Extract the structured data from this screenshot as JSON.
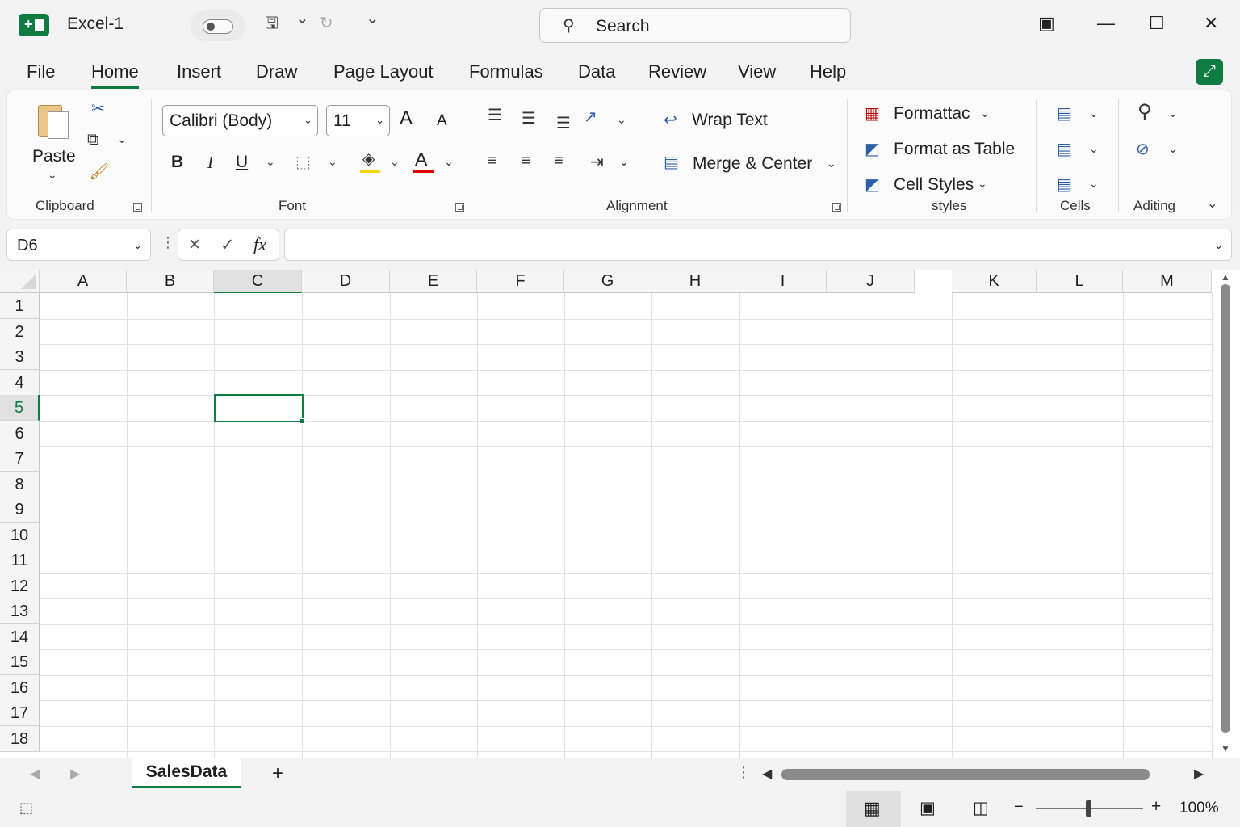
{
  "titlebar": {
    "doc_title": "Excel-1",
    "search_placeholder": "Search",
    "icons": [
      "excel-logo",
      "autosave-toggle",
      "save-icon",
      "undo-dropdown",
      "redo-icon",
      "customize-qat-icon",
      "search-icon",
      "ribbon-display-icon",
      "minimize-icon",
      "maximize-icon",
      "close-icon"
    ],
    "glyphs": {
      "save": "🖫",
      "chev": "⌄",
      "redo": "↻",
      "customize": "⌄",
      "search": "⚲",
      "ribbon": "▣",
      "minimize": "—",
      "maximize": "☐",
      "close": "✕"
    }
  },
  "tabs": [
    {
      "label": "File",
      "active": false
    },
    {
      "label": "Home",
      "active": true
    },
    {
      "label": "Insert",
      "active": false
    },
    {
      "label": "Draw",
      "active": false
    },
    {
      "label": "Page Layout",
      "active": false
    },
    {
      "label": "Formulas",
      "active": false
    },
    {
      "label": "Data",
      "active": false
    },
    {
      "label": "Review",
      "active": false
    },
    {
      "label": "View",
      "active": false
    },
    {
      "label": "Help",
      "active": false
    }
  ],
  "ribbon": {
    "clipboard": {
      "paste_label": "Paste",
      "group_label": "Clipboard"
    },
    "font": {
      "name": "Calibri (Body)",
      "size": "11",
      "group_label": "Font",
      "bold": "B",
      "italic": "I",
      "underline": "U",
      "font_color": "A",
      "grow": "A",
      "shrink": "A",
      "highlight_color": "#f5d400",
      "font_color_bar": "#e00000"
    },
    "alignment": {
      "wrap_text": "Wrap Text",
      "merge_center": "Merge & Center",
      "group_label": "Alignment"
    },
    "styles": {
      "conditional": "Formattac",
      "format_table": "Format as Table",
      "cell_styles": "Cell Styles",
      "group_label": "styles"
    },
    "cells": {
      "group_label": "Cells"
    },
    "editing": {
      "group_label": "Aditing"
    }
  },
  "formula_bar": {
    "name_box": "D6",
    "cancel": "✕",
    "enter": "✓",
    "fx": "fx",
    "value": ""
  },
  "grid": {
    "columns": [
      "A",
      "B",
      "C",
      "D",
      "E",
      "F",
      "G",
      "H",
      "I",
      "J",
      "K",
      "L",
      "M"
    ],
    "rows": [
      "1",
      "2",
      "3",
      "4",
      "5",
      "6",
      "7",
      "8",
      "9",
      "10",
      "11",
      "12",
      "13",
      "14",
      "15",
      "16",
      "17",
      "18"
    ],
    "selected_column": "C",
    "selected_row": "5"
  },
  "sheets": {
    "tabs": [
      "SalesData"
    ],
    "add": "+"
  },
  "status": {
    "zoom": "100%",
    "zoom_out": "−",
    "zoom_in": "+"
  },
  "colors": {
    "accent": "#107c41"
  }
}
